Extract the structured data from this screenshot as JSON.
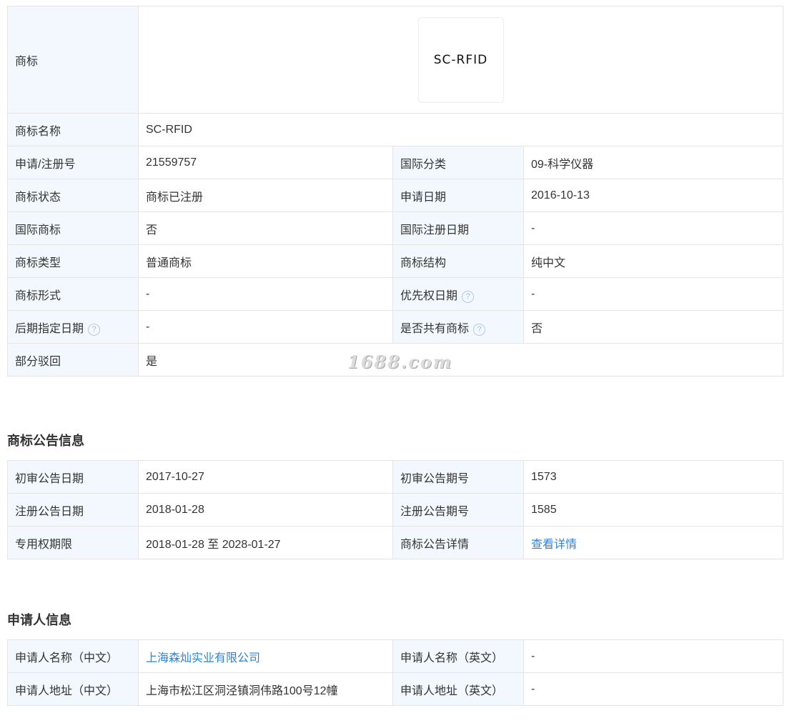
{
  "basic": {
    "logo_label": "商标",
    "logo_text": "SC-RFID",
    "name_label": "商标名称",
    "name_value": "SC-RFID",
    "reg_no_label": "申请/注册号",
    "reg_no_value": "21559757",
    "intl_class_label": "国际分类",
    "intl_class_value": "09-科学仪器",
    "status_label": "商标状态",
    "status_value": "商标已注册",
    "apply_date_label": "申请日期",
    "apply_date_value": "2016-10-13",
    "intl_mark_label": "国际商标",
    "intl_mark_value": "否",
    "intl_reg_date_label": "国际注册日期",
    "intl_reg_date_value": "-",
    "type_label": "商标类型",
    "type_value": "普通商标",
    "structure_label": "商标结构",
    "structure_value": "纯中文",
    "form_label": "商标形式",
    "form_value": "-",
    "priority_date_label": "优先权日期",
    "priority_date_value": "-",
    "later_date_label": "后期指定日期",
    "later_date_value": "-",
    "shared_label": "是否共有商标",
    "shared_value": "否",
    "partial_reject_label": "部分驳回",
    "partial_reject_value": "是",
    "help_glyph": "?"
  },
  "watermark": "1688.com",
  "announcement": {
    "title": "商标公告信息",
    "prelim_date_label": "初审公告日期",
    "prelim_date_value": "2017-10-27",
    "prelim_no_label": "初审公告期号",
    "prelim_no_value": "1573",
    "reg_date_label": "注册公告日期",
    "reg_date_value": "2018-01-28",
    "reg_no_label": "注册公告期号",
    "reg_no_value": "1585",
    "term_label": "专用权期限",
    "term_value": "2018-01-28 至 2028-01-27",
    "detail_label": "商标公告详情",
    "detail_link": "查看详情"
  },
  "applicant": {
    "title": "申请人信息",
    "name_cn_label": "申请人名称（中文）",
    "name_cn_value": "上海森灿实业有限公司",
    "name_en_label": "申请人名称（英文）",
    "name_en_value": "-",
    "addr_cn_label": "申请人地址（中文）",
    "addr_cn_value": "上海市松江区洞泾镇洞伟路100号12幢",
    "addr_en_label": "申请人地址（英文）",
    "addr_en_value": "-"
  },
  "colors": {
    "label_bg": "#f2f8fe",
    "border": "#e4e4e4",
    "link": "#2f83d6",
    "text": "#333333"
  },
  "icons": {
    "help": "question-circle-icon"
  }
}
